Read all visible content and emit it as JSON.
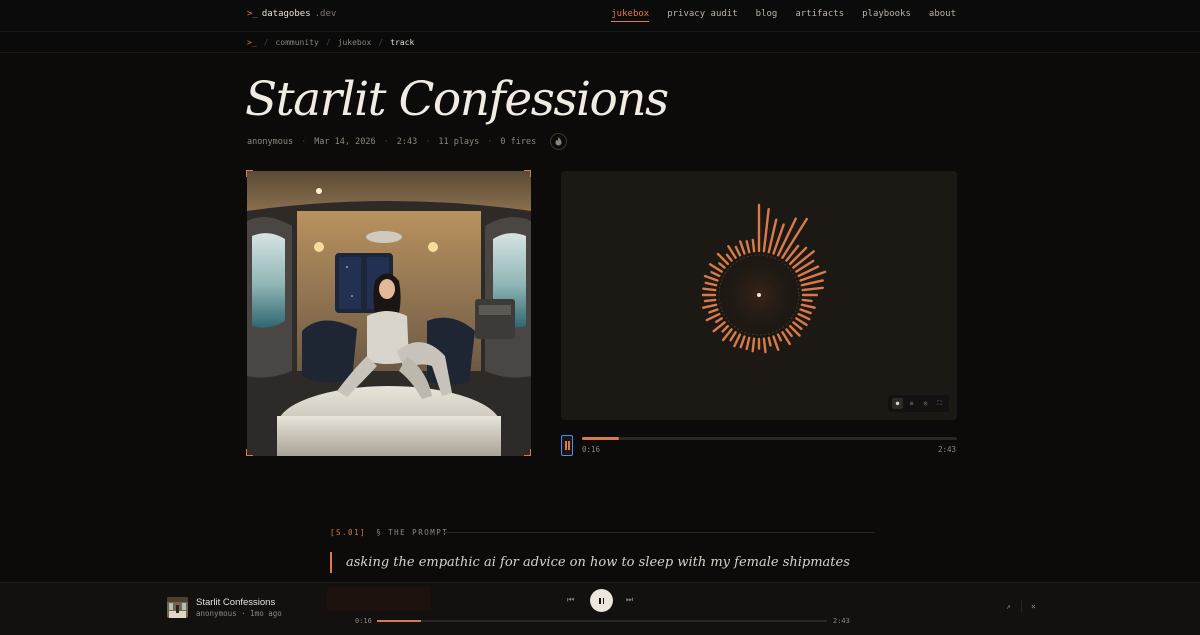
{
  "site": {
    "prompt": ">_",
    "name": "datagobes",
    "tld": ".dev"
  },
  "nav": {
    "items": [
      {
        "label": "jukebox",
        "active": true
      },
      {
        "label": "privacy audit"
      },
      {
        "label": "blog"
      },
      {
        "label": "artifacts"
      },
      {
        "label": "playbooks"
      },
      {
        "label": "about"
      }
    ]
  },
  "breadcrumb": {
    "prompt": ">_",
    "items": [
      "community",
      "jukebox",
      "track"
    ],
    "sep": "/"
  },
  "track": {
    "title": "Starlit Confessions",
    "author": "anonymous",
    "date": "Mar 14, 2026",
    "duration": "2:43",
    "plays": "11 plays",
    "fires": "0 fires",
    "fire_icon": "flame-icon"
  },
  "player": {
    "current_time": "0:16",
    "duration": "2:43",
    "progress": 0.098,
    "viz_modes": [
      {
        "icon": "radial-mode-icon",
        "glyph": "●",
        "active": true
      },
      {
        "icon": "bars-mode-icon",
        "glyph": "≡"
      },
      {
        "icon": "ring-mode-icon",
        "glyph": "◎"
      },
      {
        "icon": "fullscreen-icon",
        "glyph": "⛶"
      }
    ]
  },
  "prompt_section": {
    "number": "[S.01]",
    "heading": "§ THE PROMPT",
    "text": "asking the empathic ai for advice on how to sleep with my female shipmates"
  },
  "mini_player": {
    "title": "Starlit Confessions",
    "subtitle": "anonymous · 1mo ago",
    "current_time": "0:16",
    "duration": "2:43",
    "progress": 0.098,
    "prev_glyph": "⏮",
    "next_glyph": "⏭",
    "expand_glyph": "↗",
    "close_glyph": "×"
  },
  "colors": {
    "accent": "#d97a4a",
    "bg": "#0c0b0a",
    "panel": "#1c1814"
  }
}
